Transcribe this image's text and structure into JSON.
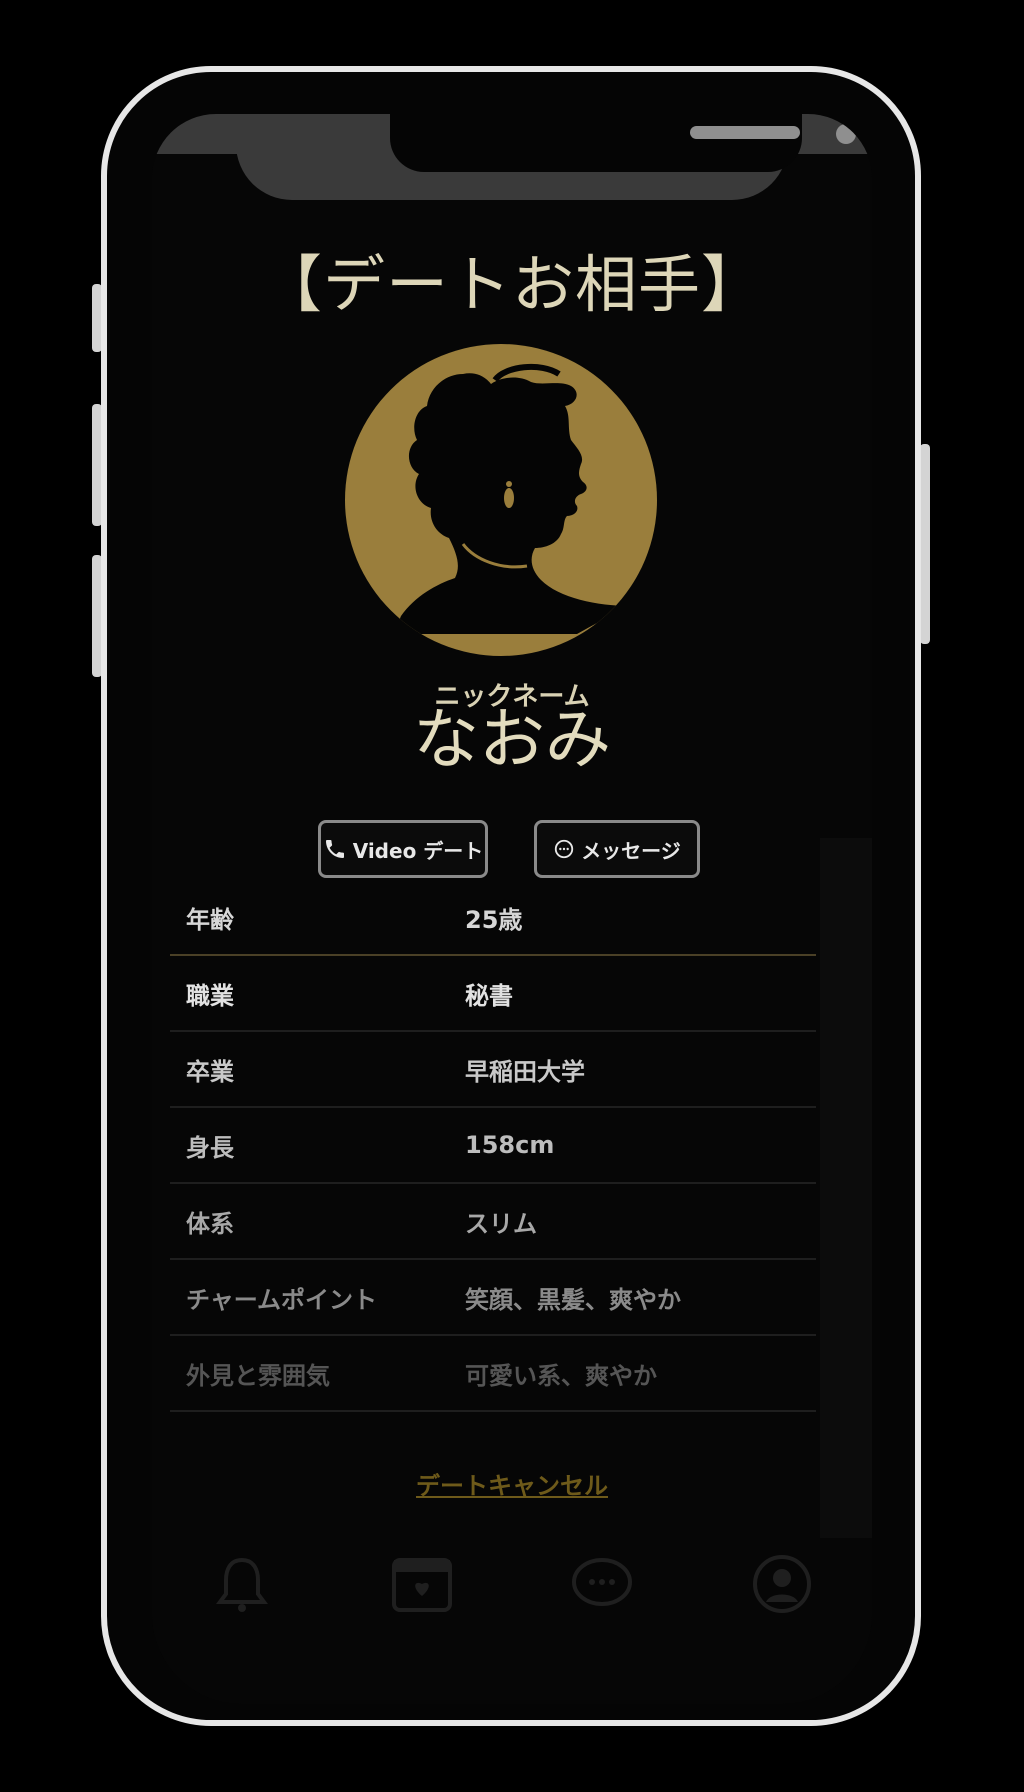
{
  "page": {
    "title": "【デートお相手】",
    "nickname_label": "ニックネーム",
    "nickname": "なおみ"
  },
  "actions": {
    "video_label": "Video デート",
    "message_label": "メッセージ"
  },
  "profile_rows": [
    {
      "key": "年齢",
      "value": "25歳",
      "color": "#d6d6d6"
    },
    {
      "key": "職業",
      "value": "秘書",
      "color": "#e2e2e2"
    },
    {
      "key": "卒業",
      "value": "早稲田大学",
      "color": "#c9c9c9"
    },
    {
      "key": "身長",
      "value": "158cm",
      "color": "#bdbdbd"
    },
    {
      "key": "体系",
      "value": "スリム",
      "color": "#a8a8a8"
    },
    {
      "key": "チャームポイント",
      "value": "笑顔、黒髪、爽やか",
      "color": "#8a8a8a"
    },
    {
      "key": "外見と雰囲気",
      "value": "可愛い系、爽やか",
      "color": "#555555"
    }
  ],
  "cancel_label": "デートキャンセル",
  "tabs": [
    {
      "icon": "bell-icon",
      "label": ""
    },
    {
      "icon": "calendar-icon",
      "label": ""
    },
    {
      "icon": "chat-icon",
      "label": ""
    },
    {
      "icon": "profile-icon",
      "label": ""
    }
  ],
  "colors": {
    "accent_gold": "#9a7e3c",
    "background": "#060606",
    "title_text": "#ddd6b8"
  }
}
